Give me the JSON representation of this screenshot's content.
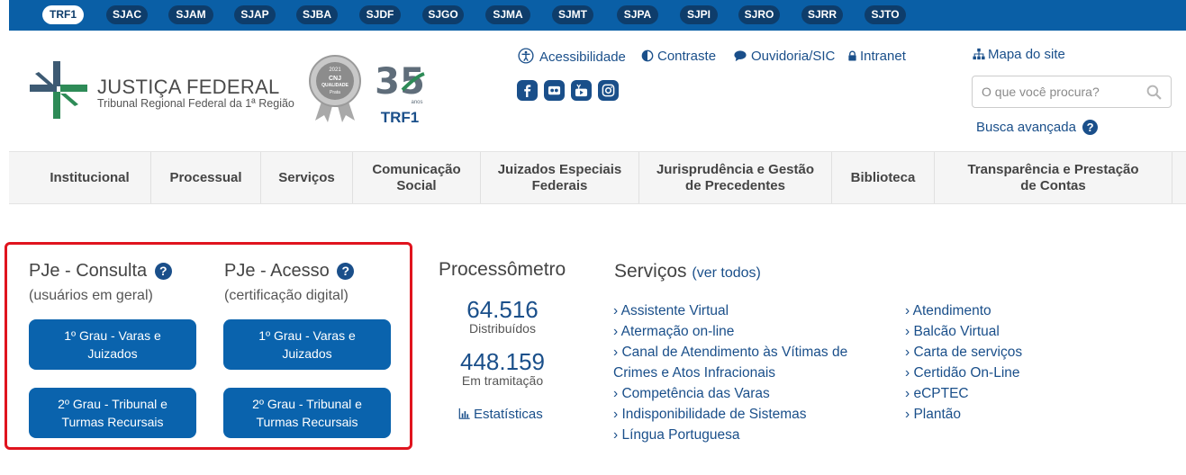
{
  "units": [
    "TRF1",
    "SJAC",
    "SJAM",
    "SJAP",
    "SJBA",
    "SJDF",
    "SJGO",
    "SJMA",
    "SJMT",
    "SJPA",
    "SJPI",
    "SJRO",
    "SJRR",
    "SJTO"
  ],
  "active_unit": "TRF1",
  "brand": {
    "title": "JUSTIÇA FEDERAL",
    "subtitle": "Tribunal Regional Federal da 1ª Região",
    "seal_year": "2021",
    "seal_line1": "CNJ",
    "seal_line2": "QUALIDADE",
    "seal_line3": "Prata",
    "anniversary_number": "35",
    "anniversary_word": "anos",
    "anniversary_label": "TRF1"
  },
  "utility_links": {
    "accessibility": "Acessibilidade",
    "contrast": "Contraste",
    "ombudsman": "Ouvidoria/SIC",
    "intranet": "Intranet",
    "sitemap": "Mapa do site"
  },
  "social": [
    "facebook-icon",
    "flickr-icon",
    "youtube-icon",
    "instagram-icon"
  ],
  "search": {
    "placeholder": "O que você procura?",
    "advanced": "Busca avançada",
    "help_glyph": "?"
  },
  "nav": [
    "Institucional",
    "Processual",
    "Serviços",
    "Comunicação Social",
    "Juizados Especiais Federais",
    "Jurisprudência e Gestão de Precedentes",
    "Biblioteca",
    "Transparência e Prestação de Contas"
  ],
  "pje": {
    "consulta_title": "PJe - Consulta",
    "consulta_sub": "(usuários em geral)",
    "acesso_title": "PJe - Acesso",
    "acesso_sub": "(certificação digital)",
    "btn_first": "1º Grau - Varas e Juizados",
    "btn_second": "2º Grau - Tribunal e Turmas Recursais"
  },
  "processometro": {
    "title": "Processômetro",
    "distributed_value": "64.516",
    "distributed_label": "Distribuídos",
    "pending_value": "448.159",
    "pending_label": "Em tramitação",
    "stats_link": "Estatísticas"
  },
  "services": {
    "title": "Serviços",
    "see_all": "(ver todos)",
    "col1": [
      "› Assistente Virtual",
      "› Atermação on-line",
      "› Canal de Atendimento às Vítimas de Crimes e Atos Infracionais",
      "› Competência das Varas",
      "› Indisponibilidade de Sistemas",
      "› Língua Portuguesa"
    ],
    "col2": [
      "› Atendimento",
      "› Balcão Virtual",
      "› Carta de serviços",
      "› Certidão On-Line",
      "› eCPTEC",
      "› Plantão"
    ]
  },
  "colors": {
    "topbar": "#0a5fa6",
    "pill": "#0e3d6b",
    "link": "#1a4f8a",
    "button": "#0a63ad",
    "highlight": "#e0141e"
  }
}
